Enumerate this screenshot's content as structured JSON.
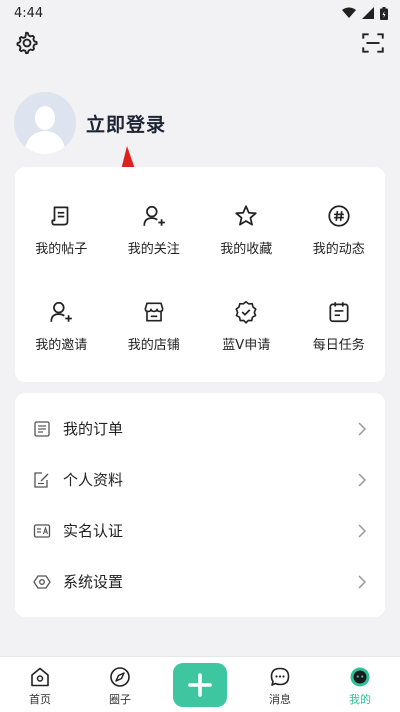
{
  "status_bar": {
    "time": "4:44"
  },
  "profile": {
    "login_label": "立即登录"
  },
  "grid": [
    {
      "label": "我的帖子",
      "icon": "post-icon"
    },
    {
      "label": "我的关注",
      "icon": "follow-user-icon"
    },
    {
      "label": "我的收藏",
      "icon": "star-icon"
    },
    {
      "label": "我的动态",
      "icon": "hashtag-icon"
    },
    {
      "label": "我的邀请",
      "icon": "invite-user-icon"
    },
    {
      "label": "我的店铺",
      "icon": "store-icon"
    },
    {
      "label": "蓝V申请",
      "icon": "verified-badge-icon"
    },
    {
      "label": "每日任务",
      "icon": "calendar-icon"
    }
  ],
  "list": [
    {
      "label": "我的订单",
      "icon": "order-icon"
    },
    {
      "label": "个人资料",
      "icon": "profile-edit-icon"
    },
    {
      "label": "实名认证",
      "icon": "id-card-icon"
    },
    {
      "label": "系统设置",
      "icon": "hexagon-settings-icon"
    }
  ],
  "nav": {
    "home": "首页",
    "circle": "圈子",
    "messages": "消息",
    "mine": "我的"
  },
  "colors": {
    "accent": "#2cc29a",
    "add_button": "#3ec6a0",
    "background": "#f2f2f4"
  }
}
